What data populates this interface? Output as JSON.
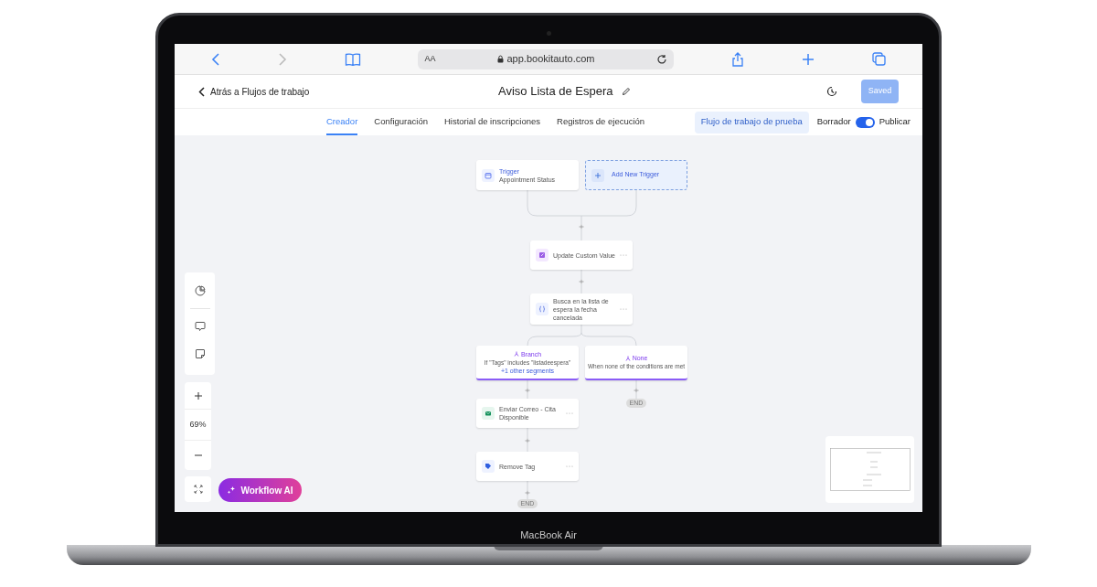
{
  "browser": {
    "text_size": "AA",
    "url": "app.bookitauto.com"
  },
  "header": {
    "back": "Atrás a Flujos de trabajo",
    "title": "Aviso Lista de Espera",
    "save": "Saved"
  },
  "tabs": [
    {
      "label": "Creador",
      "selected": true
    },
    {
      "label": "Configuración",
      "selected": false
    },
    {
      "label": "Historial de inscripciones",
      "selected": false
    },
    {
      "label": "Registros de ejecución",
      "selected": false
    }
  ],
  "test_button": "Flujo de trabajo de prueba",
  "publish": {
    "draft_label": "Borrador",
    "label": "Publicar",
    "on": true
  },
  "nodes": [
    {
      "kind": "trigger",
      "title": "Trigger",
      "subtitle": "Appointment Status"
    },
    {
      "kind": "add_trigger",
      "title": "Add New Trigger"
    },
    {
      "kind": "update",
      "title": "Update Custom Value"
    },
    {
      "kind": "code",
      "title": "Busca en la lista de espera la fecha cancelada"
    },
    {
      "kind": "branch",
      "title": "Branch",
      "subtitle": "If \"Tags\" includes \"listadeespera\"",
      "link": "+1 other segments"
    },
    {
      "kind": "branch",
      "title": "None",
      "subtitle": "When none of the conditions are met"
    },
    {
      "kind": "email",
      "title": "Enviar Correo - Cita Disponible"
    },
    {
      "kind": "tag",
      "title": "Remove Tag"
    },
    {
      "kind": "end",
      "title": "END"
    },
    {
      "kind": "end",
      "title": "END"
    }
  ],
  "zoom": "69%",
  "ai_button": "Workflow AI",
  "device_label": "MacBook Air"
}
